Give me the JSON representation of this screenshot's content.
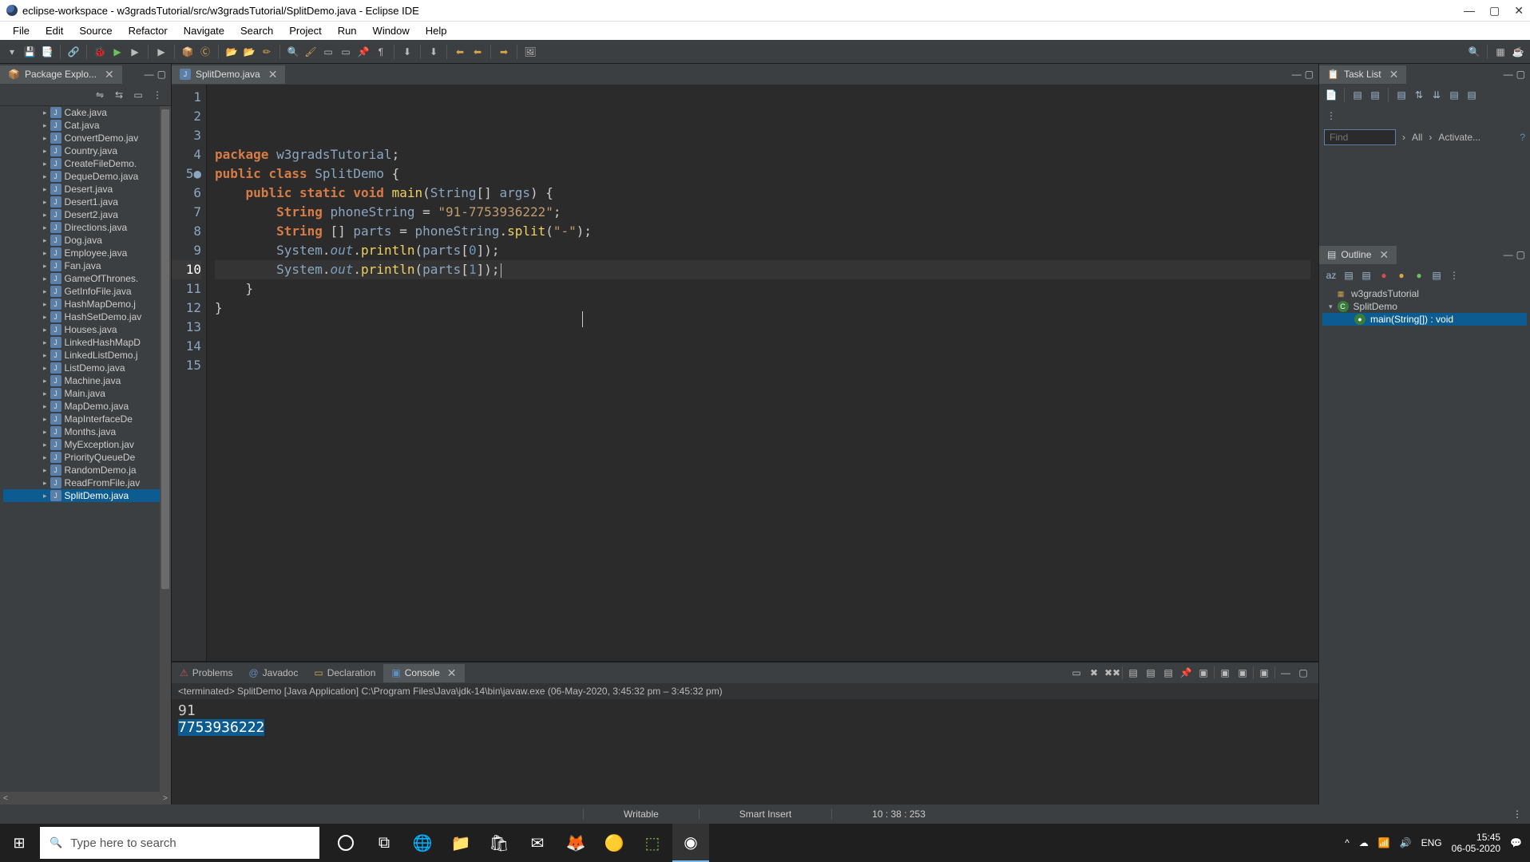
{
  "titlebar": "eclipse-workspace - w3gradsTutorial/src/w3gradsTutorial/SplitDemo.java - Eclipse IDE",
  "menubar": [
    "File",
    "Edit",
    "Source",
    "Refactor",
    "Navigate",
    "Search",
    "Project",
    "Run",
    "Window",
    "Help"
  ],
  "left_panel": {
    "title": "Package Explo...",
    "files": [
      "Cake.java",
      "Cat.java",
      "ConvertDemo.jav",
      "Country.java",
      "CreateFileDemo.",
      "DequeDemo.java",
      "Desert.java",
      "Desert1.java",
      "Desert2.java",
      "Directions.java",
      "Dog.java",
      "Employee.java",
      "Fan.java",
      "GameOfThrones.",
      "GetInfoFile.java",
      "HashMapDemo.j",
      "HashSetDemo.jav",
      "Houses.java",
      "LinkedHashMapD",
      "LinkedListDemo.j",
      "ListDemo.java",
      "Machine.java",
      "Main.java",
      "MapDemo.java",
      "MapInterfaceDe",
      "Months.java",
      "MyException.jav",
      "PriorityQueueDe",
      "RandomDemo.ja",
      "ReadFromFile.jav",
      "SplitDemo.java"
    ],
    "selected": "SplitDemo.java"
  },
  "editor": {
    "tab": "SplitDemo.java",
    "lines": [
      {
        "n": 1,
        "html": "<span class='kw'>package</span> <span class='cls'>w3gradsTutorial</span>;"
      },
      {
        "n": 2,
        "html": ""
      },
      {
        "n": 3,
        "html": "<span class='kw'>public</span> <span class='kw'>class</span> <span class='cls'>SplitDemo</span> {"
      },
      {
        "n": 4,
        "html": ""
      },
      {
        "n": 5,
        "mark": "run",
        "html": "    <span class='kw'>public</span> <span class='kw'>static</span> <span class='kw'>void</span> <span class='fn'>main</span>(<span class='cls'>String</span>[] <span class='cls'>args</span>) {"
      },
      {
        "n": 6,
        "html": ""
      },
      {
        "n": 7,
        "html": "        <span class='typ'>String</span> <span class='cls'>phoneString</span> = <span class='str'>\"91-7753936222\"</span>;"
      },
      {
        "n": 8,
        "html": "        <span class='typ'>String</span> [] <span class='cls'>parts</span> = <span class='cls'>phoneString</span>.<span class='fn'>split</span>(<span class='str'>\"-\"</span>);"
      },
      {
        "n": 9,
        "html": "        <span class='cls'>System</span>.<span class='it'>out</span>.<span class='fn'>println</span>(<span class='cls'>parts</span>[<span class='num'>0</span>]);"
      },
      {
        "n": 10,
        "cur": true,
        "html": "        <span class='cls'>System</span>.<span class='it'>out</span>.<span class='fn'>println</span>(<span class='cls'>parts</span>[<span class='num'>1</span>]);|"
      },
      {
        "n": 11,
        "html": ""
      },
      {
        "n": 12,
        "html": "    }"
      },
      {
        "n": 13,
        "html": ""
      },
      {
        "n": 14,
        "html": "}"
      },
      {
        "n": 15,
        "html": ""
      }
    ]
  },
  "console": {
    "tabs": [
      "Problems",
      "Javadoc",
      "Declaration",
      "Console"
    ],
    "active": "Console",
    "status": "<terminated> SplitDemo [Java Application] C:\\Program Files\\Java\\jdk-14\\bin\\javaw.exe  (06-May-2020, 3:45:32 pm – 3:45:32 pm)",
    "out_line1": "91",
    "out_line2": "7753936222"
  },
  "right": {
    "task_title": "Task List",
    "find_placeholder": "Find",
    "find_all": "All",
    "find_activate": "Activate...",
    "outline_title": "Outline",
    "outline": {
      "pkg": "w3gradsTutorial",
      "class": "SplitDemo",
      "method": "main(String[]) : void"
    }
  },
  "status": {
    "writable": "Writable",
    "insert": "Smart Insert",
    "pos": "10 : 38 : 253"
  },
  "taskbar": {
    "search_placeholder": "Type here to search",
    "time": "15:45",
    "date": "06-05-2020",
    "lang": "ENG"
  }
}
